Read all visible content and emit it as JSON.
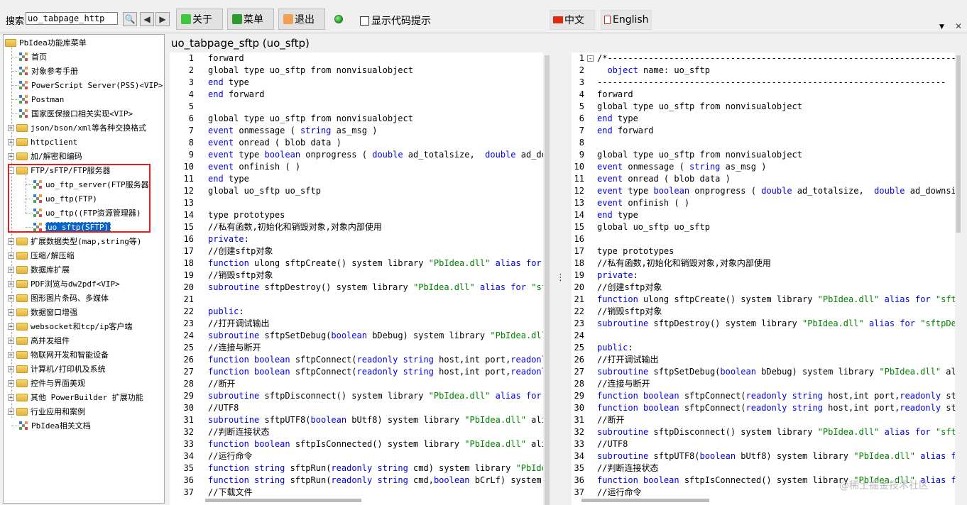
{
  "toolbar": {
    "search_label": "搜索",
    "search_value": "uo_tabpage_http",
    "buttons": {
      "about": "关于",
      "menu": "菜单",
      "exit": "退出"
    },
    "show_code_hint": "显示代码提示",
    "lang_zh": "中文",
    "lang_en": "English"
  },
  "tree": {
    "root": "PbIdea功能库菜单",
    "items": [
      {
        "label": "首页"
      },
      {
        "label": "对象参考手册"
      },
      {
        "label": "PowerScript Server(PSS)<VIP>"
      },
      {
        "label": "Postman"
      },
      {
        "label": "国家医保接口相关实现<VIP>"
      },
      {
        "label": "json/bson/xml等各种交换格式"
      },
      {
        "label": "httpclient"
      },
      {
        "label": "加/解密和编码"
      },
      {
        "label": "FTP/sFTP/FTP服务器"
      },
      {
        "label": "uo_ftp_server(FTP服务器"
      },
      {
        "label": "uo_ftp(FTP)"
      },
      {
        "label": "uo_ftp((FTP资源管理器)"
      },
      {
        "label": "uo_sftp(SFTP)"
      },
      {
        "label": "扩展数据类型(map,string等)"
      },
      {
        "label": "压缩/解压缩"
      },
      {
        "label": "数据库扩展"
      },
      {
        "label": "PDF浏览与dw2pdf<VIP>"
      },
      {
        "label": "图形图片条码、多媒体"
      },
      {
        "label": "数据窗口增强"
      },
      {
        "label": "websocket和tcp/ip客户端"
      },
      {
        "label": "高并发组件"
      },
      {
        "label": "物联网开发和智能设备"
      },
      {
        "label": "计算机/打印机及系统"
      },
      {
        "label": "控件与界面美观"
      },
      {
        "label": "其他 PowerBuilder 扩展功能"
      },
      {
        "label": "行业应用和案例"
      },
      {
        "label": "PbIdea相关文档"
      }
    ]
  },
  "page_title": "uo_tabpage_sftp (uo_sftp)",
  "left_code": [
    [
      "1",
      "forward"
    ],
    [
      "2",
      "global type uo_sftp from nonvisualobject"
    ],
    [
      "3",
      "end type"
    ],
    [
      "4",
      "end forward"
    ],
    [
      "5",
      ""
    ],
    [
      "6",
      "global type uo_sftp from nonvisualobject"
    ],
    [
      "7",
      "event onmessage ( string as_msg )"
    ],
    [
      "8",
      "event onread ( blob data )"
    ],
    [
      "9",
      "event type boolean onprogress ( double ad_totalsize,  double ad_dow"
    ],
    [
      "10",
      "event onfinish ( )"
    ],
    [
      "11",
      "end type"
    ],
    [
      "12",
      "global uo_sftp uo_sftp"
    ],
    [
      "13",
      ""
    ],
    [
      "14",
      "type prototypes"
    ],
    [
      "15",
      "//私有函数,初始化和销毁对象,对象内部使用"
    ],
    [
      "16",
      "private:"
    ],
    [
      "17",
      "//创建sftp对象"
    ],
    [
      "18",
      "function ulong sftpCreate() system library \"PbIdea.dll\" alias for \""
    ],
    [
      "19",
      "//销毁sftp对象"
    ],
    [
      "20",
      "subroutine sftpDestroy() system library \"PbIdea.dll\" alias for \"sft"
    ],
    [
      "21",
      ""
    ],
    [
      "22",
      "public:"
    ],
    [
      "23",
      "//打开调试输出"
    ],
    [
      "24",
      "subroutine sftpSetDebug(boolean bDebug) system library \"PbIdea.dll\""
    ],
    [
      "25",
      "//连接与断开"
    ],
    [
      "26",
      "function boolean sftpConnect(readonly string host,int port,readonly"
    ],
    [
      "27",
      "function boolean sftpConnect(readonly string host,int port,readonly"
    ],
    [
      "28",
      "//断开"
    ],
    [
      "29",
      "subroutine sftpDisconnect() system library \"PbIdea.dll\" alias for \""
    ],
    [
      "30",
      "//UTF8"
    ],
    [
      "31",
      "subroutine sftpUTF8(boolean bUtf8) system library \"PbIdea.dll\" alia"
    ],
    [
      "32",
      "//判断连接状态"
    ],
    [
      "33",
      "function boolean sftpIsConnected() system library \"PbIdea.dll\" alia"
    ],
    [
      "34",
      "//运行命令"
    ],
    [
      "35",
      "function string sftpRun(readonly string cmd) system library \"PbIdea"
    ],
    [
      "36",
      "function string sftpRun(readonly string cmd,boolean bCrLf) system l"
    ],
    [
      "37",
      "//下载文件"
    ]
  ],
  "right_code": [
    [
      "1",
      "/*--------------------------------------------------------------------"
    ],
    [
      "2",
      "  object name: uo_sftp"
    ],
    [
      "3",
      "--------------------------------------------------------------------"
    ],
    [
      "4",
      "forward"
    ],
    [
      "5",
      "global type uo_sftp from nonvisualobject"
    ],
    [
      "6",
      "end type"
    ],
    [
      "7",
      "end forward"
    ],
    [
      "8",
      ""
    ],
    [
      "9",
      "global type uo_sftp from nonvisualobject"
    ],
    [
      "10",
      "event onmessage ( string as_msg )"
    ],
    [
      "11",
      "event onread ( blob data )"
    ],
    [
      "12",
      "event type boolean onprogress ( double ad_totalsize,  double ad_downsize"
    ],
    [
      "13",
      "event onfinish ( )"
    ],
    [
      "14",
      "end type"
    ],
    [
      "15",
      "global uo_sftp uo_sftp"
    ],
    [
      "16",
      ""
    ],
    [
      "17",
      "type prototypes"
    ],
    [
      "18",
      "//私有函数,初始化和销毁对象,对象内部使用"
    ],
    [
      "19",
      "private:"
    ],
    [
      "20",
      "//创建sftp对象"
    ],
    [
      "21",
      "function ulong sftpCreate() system library \"PbIdea.dll\" alias for \"sftpC"
    ],
    [
      "22",
      "//销毁sftp对象"
    ],
    [
      "23",
      "subroutine sftpDestroy() system library \"PbIdea.dll\" alias for \"sftpDest"
    ],
    [
      "24",
      ""
    ],
    [
      "25",
      "public:"
    ],
    [
      "26",
      "//打开调试输出"
    ],
    [
      "27",
      "subroutine sftpSetDebug(boolean bDebug) system library \"PbIdea.dll\" ali"
    ],
    [
      "28",
      "//连接与断开"
    ],
    [
      "29",
      "function boolean sftpConnect(readonly string host,int port,readonly stri"
    ],
    [
      "30",
      "function boolean sftpConnect(readonly string host,int port,readonly stri"
    ],
    [
      "31",
      "//断开"
    ],
    [
      "32",
      "subroutine sftpDisconnect() system library \"PbIdea.dll\" alias for \"sftpD"
    ],
    [
      "33",
      "//UTF8"
    ],
    [
      "34",
      "subroutine sftpUTF8(boolean bUtf8) system library \"PbIdea.dll\" alias for"
    ],
    [
      "35",
      "//判断连接状态"
    ],
    [
      "36",
      "function boolean sftpIsConnected() system library \"PbIdea.dll\" alias for"
    ],
    [
      "37",
      "//运行命令"
    ]
  ],
  "watermark": "@稀土掘金技术社区",
  "colors": {
    "keyword": "#0000e0",
    "string": "#008000",
    "selection": "#0a64c8",
    "highlight_box": "#e02020"
  }
}
